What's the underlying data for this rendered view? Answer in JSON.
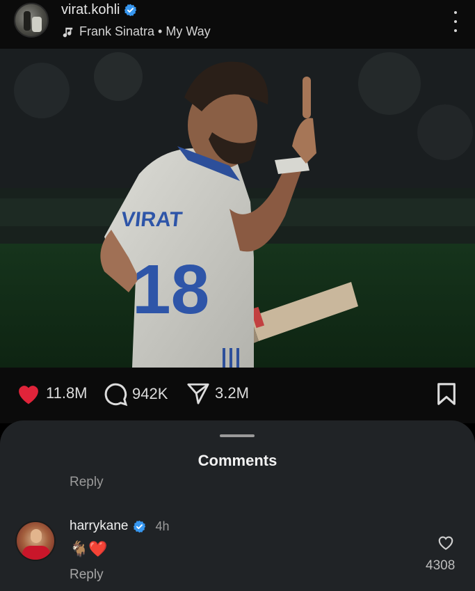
{
  "post": {
    "username": "virat.kohli",
    "audio": "Frank Sinatra • My Way",
    "jersey_name": "VIRAT",
    "jersey_number": "18"
  },
  "actions": {
    "likes": "11.8M",
    "comments": "942K",
    "shares": "3.2M"
  },
  "comments_sheet": {
    "title": "Comments",
    "previous_reply_label": "Reply",
    "comment": {
      "username": "harrykane",
      "time": "4h",
      "text": "🐐❤️",
      "reply_label": "Reply",
      "like_count": "4308"
    }
  },
  "colors": {
    "like_red": "#e0243a",
    "verified_blue": "#3797f0",
    "sheet_bg": "#202326"
  }
}
